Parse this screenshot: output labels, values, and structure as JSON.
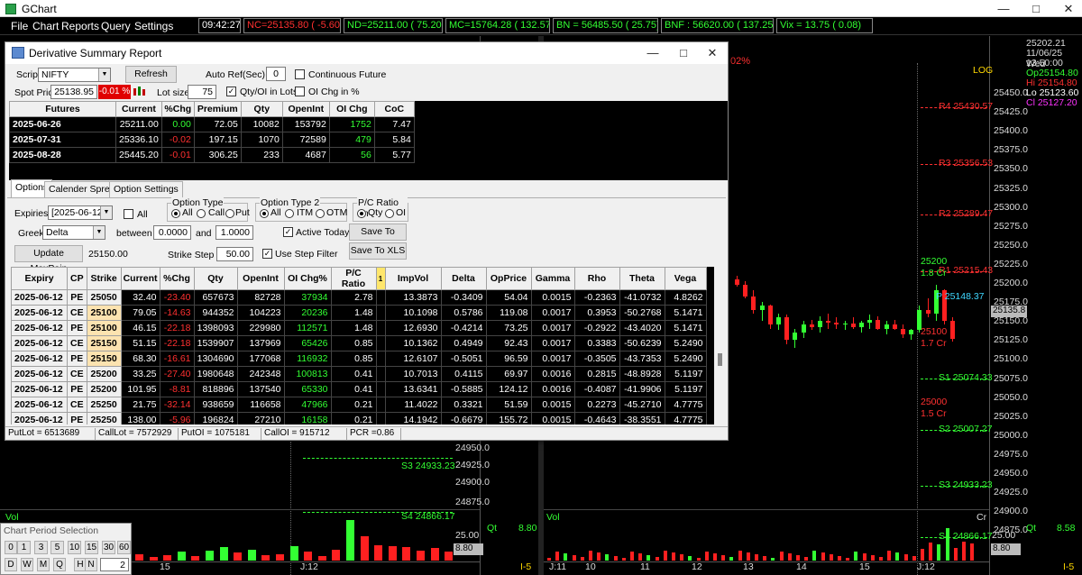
{
  "app": {
    "title": "GChart"
  },
  "menu": [
    "File",
    "Chart",
    "Reports",
    "Query",
    "Settings"
  ],
  "clock": "09:42:27",
  "tickers": [
    {
      "text": "NC=25135.80 (  -5.60)",
      "color": "#ff3030"
    },
    {
      "text": "ND=25211.00 (  75.20)",
      "color": "#33ff33"
    },
    {
      "text": "MC=15764.28 ( 132.57)",
      "color": "#33ff33"
    },
    {
      "text": "BN = 56485.50 (  25.75)",
      "color": "#33ff33"
    },
    {
      "text": "BNF : 56620.00 ( 137.25)",
      "color": "#33ff33"
    },
    {
      "text": "Vix =   13.75 (   0.08)",
      "color": "#33ff33"
    }
  ],
  "dialog": {
    "title": "Derivative Summary Report",
    "scrip_label": "Scrip",
    "scrip_value": "NIFTY",
    "refresh": "Refresh",
    "auto_ref_label": "Auto Ref(Sec)",
    "auto_ref_value": "0",
    "continuous_future": "Continuous Future",
    "spot_label": "Spot Price",
    "spot_value": "25138.95",
    "spot_chg": "-0.01 %",
    "lot_label": "Lot size",
    "lot_value": "75",
    "qty_oi_lots": "Qty/OI in Lots",
    "oi_chg_pct": "OI Chg in %",
    "futures_headers": [
      "Futures",
      "Current",
      "%Chg",
      "Premium",
      "Qty",
      "OpenInt",
      "OI Chg",
      "CoC"
    ],
    "futures_rows": [
      [
        "2025-06-26",
        "25211.00",
        "0.00",
        "72.05",
        "10082",
        "153792",
        "1752",
        "7.47"
      ],
      [
        "2025-07-31",
        "25336.10",
        "-0.02",
        "197.15",
        "1070",
        "72589",
        "479",
        "5.84"
      ],
      [
        "2025-08-28",
        "25445.20",
        "-0.01",
        "306.25",
        "233",
        "4687",
        "56",
        "5.77"
      ]
    ],
    "tabs": [
      "Options",
      "Calender Spread",
      "Option Settings"
    ],
    "expiries_label": "Expiries :",
    "expiries_value": "[2025-06-12]",
    "all_label": "All",
    "option_type_title": "Option Type",
    "option_type": [
      "All",
      "Call",
      "Put"
    ],
    "option_type2_title": "Option Type 2",
    "option_type2": [
      "All",
      "ITM",
      "OTM"
    ],
    "pc_ratio_title": "P/C Ratio  on",
    "pc_ratio": [
      "Qty",
      "OI"
    ],
    "greek_label": "Greek",
    "greek_value": "Delta",
    "between_label": "between",
    "between_from": "0.0000",
    "and_label": "and",
    "between_to": "1.0000",
    "active_today": "Active Today",
    "save_group": "Save To Group",
    "update_maxpain": "Update MaxPain",
    "maxpain_value": "25150.00",
    "strike_step_label": "Strike Step :",
    "strike_step_value": "50.00",
    "use_step_filter": "Use Step Filter",
    "save_xls": "Save To XLS",
    "options_headers": [
      "Expiry",
      "CP",
      "Strike",
      "Current",
      "%Chg",
      "Qty",
      "OpenInt",
      "OI Chg%",
      "P/C Ratio",
      "1",
      "ImpVol",
      "Delta",
      "OpPrice",
      "Gamma",
      "Rho",
      "Theta",
      "Vega"
    ],
    "options_rows": [
      [
        "2025-06-12",
        "PE",
        "25050",
        "32.40",
        "-23.40",
        "657673",
        "82728",
        "37934",
        "2.78",
        "",
        "13.3873",
        "-0.3409",
        "54.04",
        "0.0015",
        "-0.2363",
        "-41.0732",
        "4.8262"
      ],
      [
        "2025-06-12",
        "CE",
        "25100",
        "79.05",
        "-14.63",
        "944352",
        "104223",
        "20236",
        "1.48",
        "",
        "10.1098",
        "0.5786",
        "119.08",
        "0.0017",
        "0.3953",
        "-50.2768",
        "5.1471"
      ],
      [
        "2025-06-12",
        "PE",
        "25100",
        "46.15",
        "-22.18",
        "1398093",
        "229980",
        "112571",
        "1.48",
        "",
        "12.6930",
        "-0.4214",
        "73.25",
        "0.0017",
        "-0.2922",
        "-43.4020",
        "5.1471"
      ],
      [
        "2025-06-12",
        "CE",
        "25150",
        "51.15",
        "-22.18",
        "1539907",
        "137969",
        "65426",
        "0.85",
        "",
        "10.1362",
        "0.4949",
        "92.43",
        "0.0017",
        "0.3383",
        "-50.6239",
        "5.2490"
      ],
      [
        "2025-06-12",
        "PE",
        "25150",
        "68.30",
        "-16.61",
        "1304690",
        "177068",
        "116932",
        "0.85",
        "",
        "12.6107",
        "-0.5051",
        "96.59",
        "0.0017",
        "-0.3505",
        "-43.7353",
        "5.2490"
      ],
      [
        "2025-06-12",
        "CE",
        "25200",
        "33.25",
        "-27.40",
        "1980648",
        "242348",
        "100813",
        "0.41",
        "",
        "10.7013",
        "0.4115",
        "69.97",
        "0.0016",
        "0.2815",
        "-48.8928",
        "5.1197"
      ],
      [
        "2025-06-12",
        "PE",
        "25200",
        "101.95",
        "-8.81",
        "818896",
        "137540",
        "65330",
        "0.41",
        "",
        "13.6341",
        "-0.5885",
        "124.12",
        "0.0016",
        "-0.4087",
        "-41.9906",
        "5.1197"
      ],
      [
        "2025-06-12",
        "CE",
        "25250",
        "21.75",
        "-32.14",
        "938659",
        "116658",
        "47966",
        "0.21",
        "",
        "11.4022",
        "0.3321",
        "51.59",
        "0.0015",
        "0.2273",
        "-45.2710",
        "4.7775"
      ],
      [
        "2025-06-12",
        "PE",
        "25250",
        "138.00",
        "-5.96",
        "196824",
        "27210",
        "16158",
        "0.21",
        "",
        "14.1942",
        "-0.6679",
        "155.72",
        "0.0015",
        "-0.4643",
        "-38.3551",
        "4.7775"
      ]
    ],
    "status": {
      "putlot": "PutLot = 6513689",
      "calllot": "CallLot = 7572929",
      "putoi": "PutOI = 1075181",
      "calloi": "CallOI = 915712",
      "pcr": "PCR =0.86"
    }
  },
  "left_chart": {
    "price_labels": [
      "24950.0",
      "24925.0",
      "24900.0",
      "24875.0"
    ],
    "levels": [
      {
        "label": "S3 24933.23",
        "color": "#33ff33"
      },
      {
        "label": "S4 24866.17",
        "color": "#33ff33"
      }
    ],
    "vol_label": "Vol",
    "vol_axis": "25.00",
    "vol_value": "8.80",
    "date_labels": [
      "15",
      "J:12"
    ],
    "interval": "I-5"
  },
  "right_chart": {
    "pct_change": "02%",
    "log_label": "LOG",
    "info": [
      "25202.21",
      "11/06/25 Wed",
      "13:50:00"
    ],
    "ohlc": [
      {
        "text": "Op25154.80",
        "color": "#33ff33"
      },
      {
        "text": "Hi 25154.80",
        "color": "#ff3030"
      },
      {
        "text": "Lo 25123.60",
        "color": "#ffffff"
      },
      {
        "text": "Cl 25127.20",
        "color": "#ff33ff"
      }
    ],
    "price_labels": [
      "25450.0",
      "25425.0",
      "25400.0",
      "25375.0",
      "25350.0",
      "25325.0",
      "25300.0",
      "25275.0",
      "25250.0",
      "25225.0",
      "25200.0",
      "25175.0",
      "25150.0",
      "25125.0",
      "25100.0",
      "25075.0",
      "25050.0",
      "25025.0",
      "25000.0",
      "24975.0",
      "24950.0",
      "24925.0",
      "24900.0",
      "24875.0"
    ],
    "levels": [
      {
        "label": "R4 25430.57",
        "color": "#ff3030"
      },
      {
        "label": "R3 25356.53",
        "color": "#ff3030"
      },
      {
        "label": "R2 25289.47",
        "color": "#ff3030"
      },
      {
        "label": "R1 25215.43",
        "color": "#ff3030"
      },
      {
        "label": "S1 25074.33",
        "color": "#33ff33"
      },
      {
        "label": "S2 25007.27",
        "color": "#33ff33"
      },
      {
        "label": "S3 24933.23",
        "color": "#33ff33"
      },
      {
        "label": "S4 24866.17",
        "color": "#33ff33"
      }
    ],
    "oi_strikes": [
      {
        "strike": "25200",
        "oi": "1.8 Cr",
        "color": "#33ff33"
      },
      {
        "strike": "25100",
        "oi": "1.7 Cr",
        "color": "#ff3030"
      },
      {
        "strike": "25000",
        "oi": "1.5 Cr",
        "color": "#ff3030"
      }
    ],
    "pivot_label": "P 25148.37",
    "current_price": "25135.8",
    "vol_label": "Vol",
    "qt_label": "Qt",
    "qt_value": "8.58",
    "cr_label": "Cr",
    "vol_axis": "25.00",
    "vol_value": "8.80",
    "date_labels": [
      "J:11",
      "10",
      "11",
      "12",
      "13",
      "14",
      "15",
      "J:12"
    ],
    "interval": "I-5",
    "left_qt": "Qt",
    "left_qt_value": "8.80"
  },
  "period_panel": {
    "title": "Chart Period Selection",
    "row1": [
      "0",
      "1",
      "3",
      "5",
      "10",
      "15",
      "30",
      "60"
    ],
    "row2": [
      "D",
      "W",
      "M",
      "Q",
      "H",
      "N"
    ],
    "value": "2"
  }
}
